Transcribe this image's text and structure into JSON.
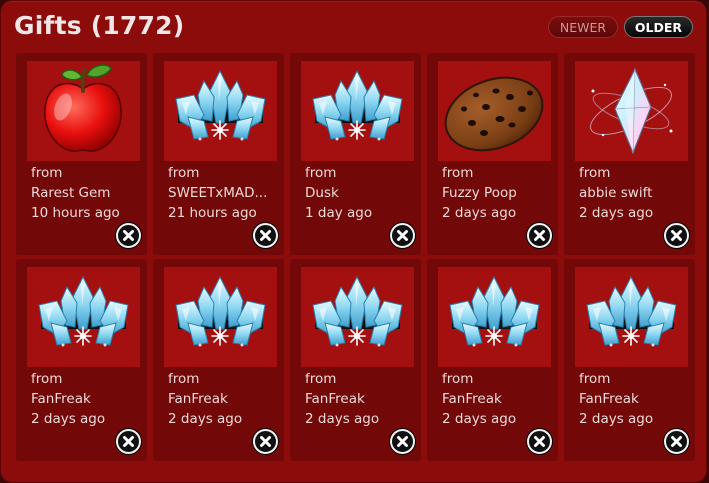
{
  "header": {
    "title": "Gifts (1772)",
    "newer_label": "NEWER",
    "older_label": "OLDER"
  },
  "gifts": [
    {
      "icon": "apple-icon",
      "from_label": "from",
      "sender": "Rarest Gem",
      "time": "10 hours ago"
    },
    {
      "icon": "ice-crown-icon",
      "from_label": "from",
      "sender": "SWEETxMAD...",
      "time": "21 hours ago"
    },
    {
      "icon": "ice-crown-icon",
      "from_label": "from",
      "sender": "Dusk",
      "time": "1 day ago"
    },
    {
      "icon": "cookie-icon",
      "from_label": "from",
      "sender": "Fuzzy Poop",
      "time": "2 days ago"
    },
    {
      "icon": "crystal-icon",
      "from_label": "from",
      "sender": "abbie swift",
      "time": "2 days ago"
    },
    {
      "icon": "ice-crown-icon",
      "from_label": "from",
      "sender": "FanFreak",
      "time": "2 days ago"
    },
    {
      "icon": "ice-crown-icon",
      "from_label": "from",
      "sender": "FanFreak",
      "time": "2 days ago"
    },
    {
      "icon": "ice-crown-icon",
      "from_label": "from",
      "sender": "FanFreak",
      "time": "2 days ago"
    },
    {
      "icon": "ice-crown-icon",
      "from_label": "from",
      "sender": "FanFreak",
      "time": "2 days ago"
    },
    {
      "icon": "ice-crown-icon",
      "from_label": "from",
      "sender": "FanFreak",
      "time": "2 days ago"
    }
  ],
  "colors": {
    "panel": "#8c0b0b",
    "card": "#720808",
    "thumb": "#a40f0f"
  }
}
